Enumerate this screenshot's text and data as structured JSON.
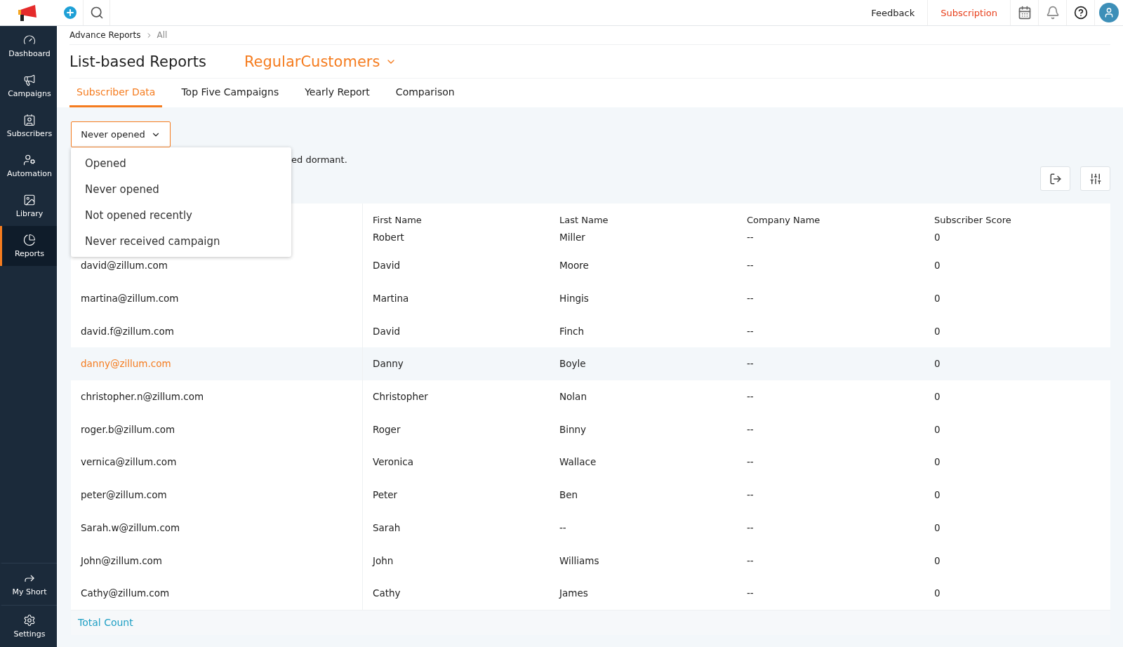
{
  "topbar": {
    "links": [
      {
        "label": "Feedback",
        "kind": "plain"
      },
      {
        "label": "Subscription",
        "kind": "accent"
      }
    ]
  },
  "sidebar": {
    "items": [
      {
        "label": "Dashboard",
        "selected": false
      },
      {
        "label": "Campaigns",
        "selected": false
      },
      {
        "label": "Subscribers",
        "selected": false
      },
      {
        "label": "Automation",
        "selected": false
      },
      {
        "label": "Library",
        "selected": false
      },
      {
        "label": "Reports",
        "selected": true
      }
    ],
    "bottom_items": [
      {
        "label": "My Short"
      },
      {
        "label": "Settings"
      }
    ]
  },
  "breadcrumb": [
    "Advance Reports",
    "All"
  ],
  "title": "List-based Reports",
  "list_selector": "RegularCustomers",
  "tabs": [
    {
      "label": "Subscriber Data",
      "selected": true
    },
    {
      "label": "Top Five Campaigns",
      "selected": false
    },
    {
      "label": "Yearly Report",
      "selected": false
    },
    {
      "label": "Comparison",
      "selected": false
    }
  ],
  "filter": {
    "value": "Never opened",
    "expanded": true,
    "options": [
      "Opened",
      "Never opened",
      "Not opened recently",
      "Never received campaign"
    ]
  },
  "description": "ed dormant.",
  "table": {
    "columns": [
      "First Name",
      "Last Name",
      "Company Name",
      "Subscriber Score"
    ],
    "rows": [
      {
        "first": "Robert",
        "last": "Miller",
        "company": "--",
        "score": "0",
        "highlighted": false
      },
      {
        "email": "david@zillum.com",
        "first": "David",
        "last": "Moore",
        "company": "--",
        "score": "0",
        "highlighted": false
      },
      {
        "email": "martina@zillum.com",
        "first": "Martina",
        "last": "Hingis",
        "company": "--",
        "score": "0",
        "highlighted": false
      },
      {
        "email": "david.f@zillum.com",
        "first": "David",
        "last": "Finch",
        "company": "--",
        "score": "0",
        "highlighted": false
      },
      {
        "email": "danny@zillum.com",
        "first": "Danny",
        "last": "Boyle",
        "company": "--",
        "score": "0",
        "highlighted": true
      },
      {
        "email": "christopher.n@zillum.com",
        "first": "Christopher",
        "last": "Nolan",
        "company": "--",
        "score": "0",
        "highlighted": false
      },
      {
        "email": "roger.b@zillum.com",
        "first": "Roger",
        "last": "Binny",
        "company": "--",
        "score": "0",
        "highlighted": false
      },
      {
        "email": "vernica@zillum.com",
        "first": "Veronica",
        "last": "Wallace",
        "company": "--",
        "score": "0",
        "highlighted": false
      },
      {
        "email": "peter@zillum.com",
        "first": "Peter",
        "last": "Ben",
        "company": "--",
        "score": "0",
        "highlighted": false
      },
      {
        "email": "Sarah.w@zillum.com",
        "first": "Sarah",
        "last": "--",
        "company": "--",
        "score": "0",
        "highlighted": false
      },
      {
        "email": "John@zillum.com",
        "first": "John",
        "last": "Williams",
        "company": "--",
        "score": "0",
        "highlighted": false
      },
      {
        "email": "Cathy@zillum.com",
        "first": "Cathy",
        "last": "James",
        "company": "--",
        "score": "0",
        "highlighted": false
      }
    ],
    "footer": "Total Count"
  }
}
